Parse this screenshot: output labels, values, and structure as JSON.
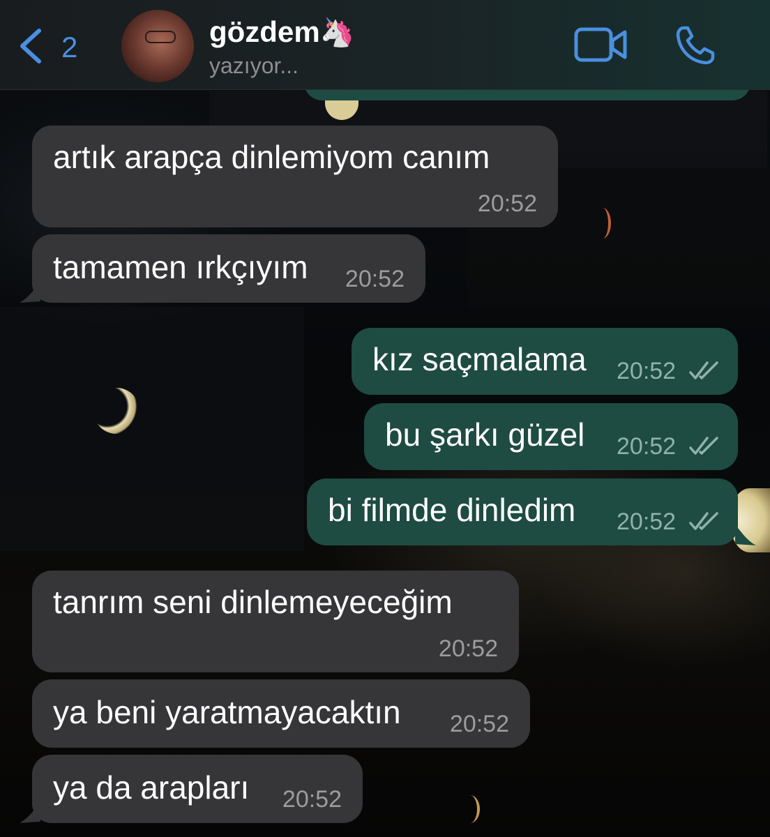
{
  "header": {
    "back_count": "2",
    "contact_name": "gözdem",
    "contact_emoji": "🦄",
    "status": "yazıyor..."
  },
  "messages": [
    {
      "direction": "incoming",
      "text": "artık arapça dinlemiyom canım",
      "time": "20:52"
    },
    {
      "direction": "incoming",
      "text": "tamamen ırkçıyım",
      "time": "20:52"
    },
    {
      "direction": "outgoing",
      "text": "kız saçmalama",
      "time": "20:52",
      "read": true
    },
    {
      "direction": "outgoing",
      "text": "bu şarkı güzel",
      "time": "20:52",
      "read": true
    },
    {
      "direction": "outgoing",
      "text": "bi filmde dinledim",
      "time": "20:52",
      "read": true
    },
    {
      "direction": "incoming",
      "text": "tanrım seni dinlemeyeceğim",
      "time": "20:52"
    },
    {
      "direction": "incoming",
      "text": "ya beni yaratmayacaktın",
      "time": "20:52"
    },
    {
      "direction": "incoming",
      "text": "ya da arapları",
      "time": "20:52"
    }
  ],
  "colors": {
    "accent": "#4a8fe0",
    "incoming_bubble": "#363638",
    "outgoing_bubble": "#1e4b42",
    "time_text": "#9c9ca0"
  },
  "icons": [
    "chevron-left-icon",
    "video-camera-icon",
    "phone-icon",
    "double-check-icon"
  ]
}
